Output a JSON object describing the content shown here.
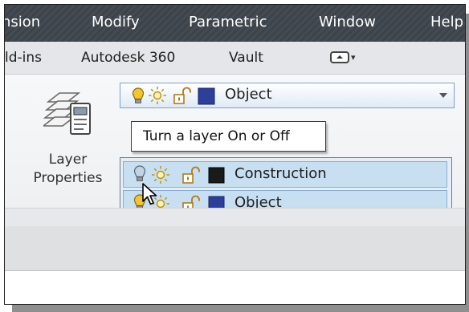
{
  "menubar": {
    "items": [
      "nsion",
      "Modify",
      "Parametric",
      "Window",
      "Help"
    ]
  },
  "tabs": {
    "items": [
      "ld-ins",
      "Autodesk 360",
      "Vault"
    ],
    "dropdown_caret": "▾"
  },
  "ribbon": {
    "layer_properties_label": "Layer\nProperties"
  },
  "layer_combo": {
    "current_layer": "Object",
    "icons": [
      "lightbulb-on-icon",
      "sun-icon",
      "unlock-icon",
      "color-swatch-icon"
    ]
  },
  "tooltip": {
    "text": "Turn a layer On or Off"
  },
  "layer_list": {
    "rows": [
      {
        "name": "Construction",
        "color": "#1a1a1a",
        "bulb_on": false
      },
      {
        "name": "Object",
        "color": "#2c3f9c",
        "bulb_on": true
      }
    ]
  },
  "colors": {
    "menubar": "#434950",
    "row_highlight": "#c8dff2",
    "bulb_on": "#f4c531",
    "object_layer": "#2c3f9c"
  }
}
